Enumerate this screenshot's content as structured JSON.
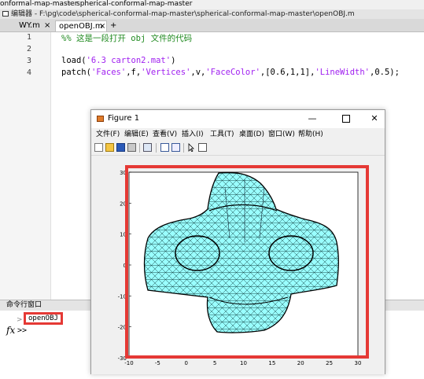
{
  "breadcrumb": {
    "first": "onformal-map-master",
    "separator": "»",
    "second": "spherical-conformal-map-master"
  },
  "editor_title": "编辑器 - F:\\pg\\code\\spherical-conformal-map-master\\spherical-conformal-map-master\\openOBJ.m",
  "tabs": [
    {
      "label": "WY.m",
      "close": "×"
    },
    {
      "label": "openOBJ.m",
      "close": "×"
    }
  ],
  "tab_add": "+",
  "code": {
    "line_numbers": [
      "1",
      "2",
      "3",
      "4"
    ],
    "line1": "%% 这是一段打开 obj 文件的代码",
    "line3_fn": "load(",
    "line3_str": "'6.3 carton2.mat'",
    "line3_end": ")",
    "line4_a": "patch(",
    "line4_b": "'Faces'",
    "line4_c": ",f,",
    "line4_d": "'Vertices'",
    "line4_e": ",v,",
    "line4_f": "'FaceColor'",
    "line4_g": ",[0.6,1,1],",
    "line4_h": "'LineWidth'",
    "line4_i": ",0.5);"
  },
  "command_window": {
    "title": "命令行窗口",
    "caret": ">",
    "entry": "openOBJ",
    "fx": "fx",
    "prompt": ">>"
  },
  "figure": {
    "title": "Figure 1",
    "minimize": "—",
    "close": "✕",
    "menus": [
      "文件(F)",
      "编辑(E)",
      "查看(V)",
      "插入(I)",
      "工具(T)",
      "桌面(D)",
      "窗口(W)",
      "帮助(H)"
    ],
    "toolbar_icons": [
      "new-figure-icon",
      "open-file-icon",
      "save-icon",
      "print-icon",
      "link-plot-icon",
      "insert-colorbar-icon",
      "insert-legend-icon",
      "edit-plot-icon",
      "property-inspector-icon"
    ]
  },
  "colors": {
    "highlight": "#e53935",
    "mesh_fill": "#99ffff",
    "comment": "#228b22",
    "string": "#a020f0"
  },
  "chart_data": {
    "type": "mesh-patch",
    "face_color": "#99ffff",
    "xlim": [
      -10,
      30
    ],
    "ylim": [
      -30,
      30
    ],
    "xticks": [
      "-10",
      "-5",
      "0",
      "5",
      "10",
      "15",
      "20",
      "25",
      "30"
    ],
    "yticks": [
      "30",
      "20",
      "10",
      "0",
      "-10",
      "-20",
      "-30"
    ],
    "grid": false
  }
}
